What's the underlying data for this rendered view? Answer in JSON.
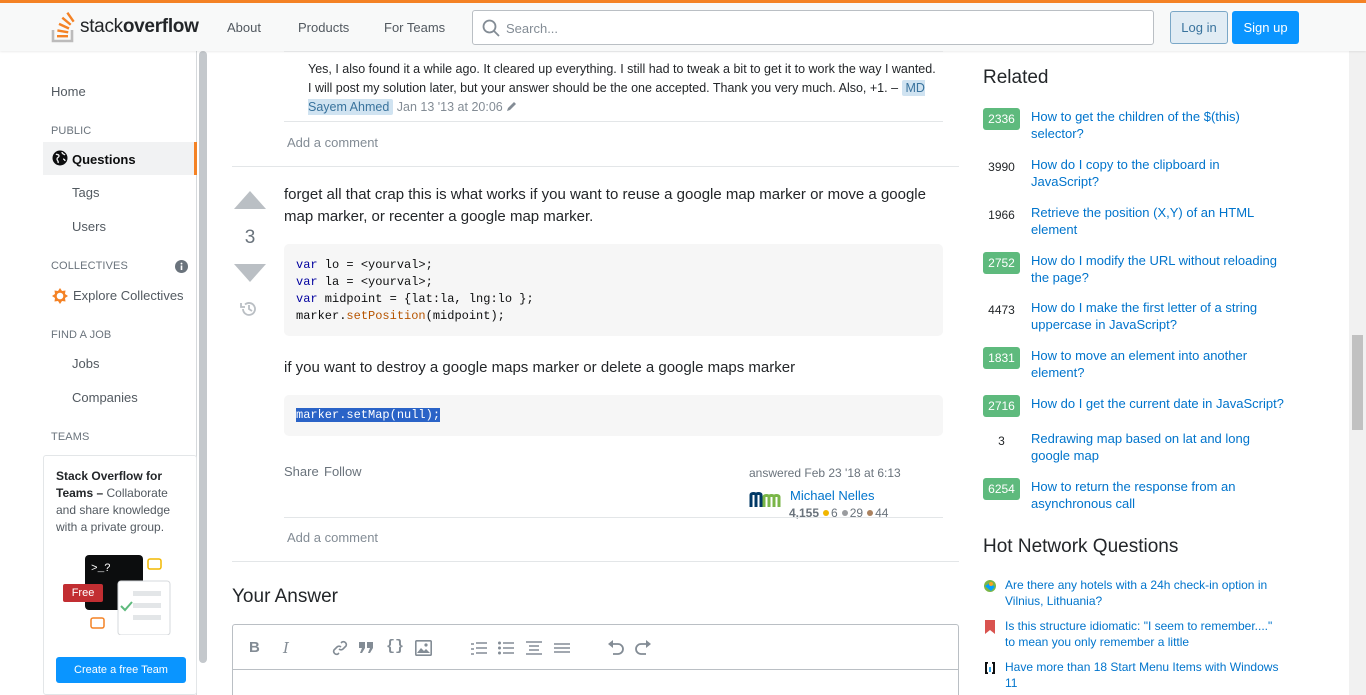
{
  "header": {
    "logo_prefix": "stack",
    "logo_bold": "overflow",
    "nav": [
      "About",
      "Products",
      "For Teams"
    ],
    "search_placeholder": "Search...",
    "login": "Log in",
    "signup": "Sign up",
    "accent_color": "#f48225"
  },
  "sidebar": {
    "home": "Home",
    "public_label": "PUBLIC",
    "questions": "Questions",
    "tags": "Tags",
    "users": "Users",
    "collectives_label": "COLLECTIVES",
    "explore_collectives": "Explore Collectives",
    "find_job_label": "FIND A JOB",
    "jobs": "Jobs",
    "companies": "Companies",
    "teams_label": "TEAMS",
    "teams_title": "Stack Overflow for Teams",
    "teams_sep": " – ",
    "teams_desc": "Collaborate and share knowledge with a private group.",
    "free_badge": "Free",
    "create_team": "Create a free Team",
    "terminal_prompt": ">_?"
  },
  "comment": {
    "text": "Yes, I also found it a while ago. It cleared up everything. I still had to tweak a bit to get it to work the way I wanted. I will post my solution later, but your answer should be the one accepted. Thank you very much. Also, +1. –",
    "author": "MD Sayem Ahmed",
    "date": "Jan 13 '13 at 20:06"
  },
  "add_comment": "Add a comment",
  "answer": {
    "votes": "3",
    "intro": "forget all that crap this is what works if you want to reuse a google map marker or move a google map marker, or recenter a google map marker.",
    "code1": [
      {
        "kw": "var",
        "rest": " lo = <yourval>;"
      },
      {
        "kw": "var",
        "rest": " la = <yourval>;"
      },
      {
        "kw": "var",
        "rest": " midpoint = {lat:la, lng:lo };"
      }
    ],
    "code1_last_obj": "marker.",
    "code1_last_fn": "setPosition",
    "code1_last_rest": "(midpoint);",
    "mid_text": "if you want to destroy a google maps marker or delete a google maps marker",
    "code2": "marker.setMap(null);",
    "share": "Share",
    "follow": "Follow",
    "answered": "answered Feb 23 '18 at 6:13",
    "user_name": "Michael Nelles",
    "user_rep": "4,155",
    "gold": "6",
    "silver": "29",
    "bronze": "44"
  },
  "your_answer": "Your Answer",
  "related": {
    "title": "Related",
    "items": [
      {
        "score": "2336",
        "accepted": true,
        "title": "How to get the children of the $(this) selector?"
      },
      {
        "score": "3990",
        "accepted": false,
        "title": "How do I copy to the clipboard in JavaScript?"
      },
      {
        "score": "1966",
        "accepted": false,
        "title": "Retrieve the position (X,Y) of an HTML element"
      },
      {
        "score": "2752",
        "accepted": true,
        "title": "How do I modify the URL without reloading the page?"
      },
      {
        "score": "4473",
        "accepted": false,
        "title": "How do I make the first letter of a string uppercase in JavaScript?"
      },
      {
        "score": "1831",
        "accepted": true,
        "title": "How to move an element into another element?"
      },
      {
        "score": "2716",
        "accepted": true,
        "title": "How do I get the current date in JavaScript?"
      },
      {
        "score": "3",
        "accepted": false,
        "title": "Redrawing map based on lat and long google map"
      },
      {
        "score": "6254",
        "accepted": true,
        "title": "How to return the response from an asynchronous call"
      }
    ]
  },
  "hnq": {
    "title": "Hot Network Questions",
    "items": [
      {
        "icon": "travel-site-icon",
        "title": "Are there any hotels with a 24h check-in option in Vilnius, Lithuania?"
      },
      {
        "icon": "english-site-icon",
        "title": "Is this structure idiomatic: \"I seem to remember....\" to mean you only remember a little"
      },
      {
        "icon": "superuser-site-icon",
        "title": "Have more than 18 Start Menu Items with Windows 11"
      }
    ]
  }
}
